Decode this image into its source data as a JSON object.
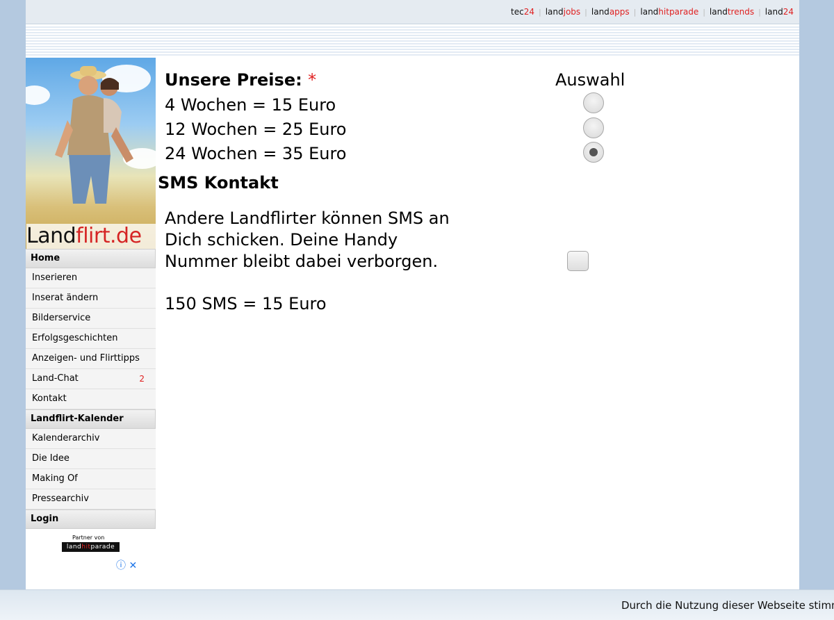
{
  "top_links": [
    {
      "pre": "tec",
      "hl": "24"
    },
    {
      "pre": "land",
      "hl": "jobs"
    },
    {
      "pre": "land",
      "hl": "apps"
    },
    {
      "pre": "land",
      "hl": "hitparade"
    },
    {
      "pre": "land",
      "hl": "trends"
    },
    {
      "pre": "land",
      "hl": "24"
    }
  ],
  "logo": {
    "part1": "Land",
    "part2": "flirt.de"
  },
  "nav": {
    "home": "Home",
    "inserieren": "Inserieren",
    "inserat_aendern": "Inserat ändern",
    "bilderservice": "Bilderservice",
    "erfolgsgeschichten": "Erfolgsgeschichten",
    "tipps": "Anzeigen- und Flirttipps",
    "land_chat": "Land-Chat",
    "land_chat_count": "2",
    "kontakt": "Kontakt",
    "kalender_head": "Landflirt-Kalender",
    "kalenderarchiv": "Kalenderarchiv",
    "die_idee": "Die Idee",
    "making_of": "Making Of",
    "pressearchiv": "Pressearchiv",
    "login": "Login"
  },
  "partner": {
    "label": "Partner von",
    "brand_pre": "land",
    "brand_hl": "hit",
    "brand_post": "parade"
  },
  "ad_icons": {
    "info": "ⓘ",
    "close": "✕"
  },
  "prices": {
    "heading": "Unsere Preise:",
    "required_mark": "*",
    "select_label": "Auswahl",
    "options": [
      {
        "label": "4 Wochen = 15 Euro",
        "checked": false
      },
      {
        "label": "12 Wochen = 25 Euro",
        "checked": false
      },
      {
        "label": "24 Wochen = 35 Euro",
        "checked": true
      }
    ]
  },
  "sms": {
    "heading": "SMS Kontakt",
    "description": "Andere Landflirter können SMS an Dich schicken. Deine Handy Nummer bleibt dabei verborgen.",
    "price": "150 SMS = 15 Euro",
    "checked": false
  },
  "cookie": {
    "text": "Durch die Nutzung dieser Webseite stimm"
  }
}
